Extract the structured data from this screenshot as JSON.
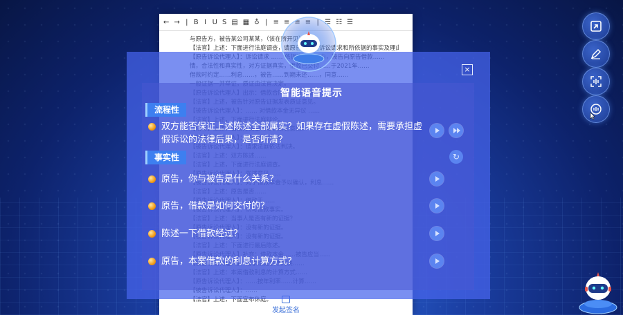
{
  "document": {
    "toolbar_glyphs": [
      "←",
      "→",
      "|",
      "B",
      "I",
      "U",
      "S",
      "▤",
      "▦",
      "♁",
      "|",
      "≡",
      "≡",
      "≡",
      "≡",
      "|",
      "☰",
      "☷",
      "☰"
    ],
    "lines": [
      "与原告方，被告某公司某某，（该在所开见）",
      "【法官】上述：下面进行法庭调查，请原告方陈述诉讼请求和所依据的事实及理由。",
      "【原告诉讼代理人】：诉讼请求 …… 依据事实与理由，被告向原告借款……",
      "情，合法性和真实性，对方证据真实，借款已交付……于2021年……",
      "借款时约定……利息……，被告……到期未还……，同意……",
      "一般证据一并举证，质证由法官决定。",
      "【原告诉讼代理人】出示：借款合同、转账凭证。",
      "【法官】上述，被告针对原告证据发表质证意见。",
      "【被告诉讼代理人】：…… 对借款本金无异议 ……",
      "【法官】上述，下面进行法庭辩论。",
      "【法官】上述：请双方当事人发表辩论意见。",
      "【原告诉讼代理人】：坚持诉讼请求。",
      "【被告诉讼代理人】：请求法庭依法判决。",
      "【法官】上述：双方陈述……",
      "【法官】上述，下面进行法庭调查。",
      "【原告诉讼代理人】：陈述意见……",
      "【被告诉讼代理人】：对于借款本金予以确认，利息……",
      "【法官】上述：原告是否……",
      "【原告诉讼代理人】：借款于……",
      "【被告诉讼代理人】：认可借款事实。",
      "【法官】上述：当事人是否有新的证据？",
      "【原告诉讼代理人】：没有新的证据。",
      "【被告诉讼代理人】：没有新的证据。",
      "【法官】上述：下面进行最后陈述。",
      "【原告诉讼代理人】补充：借款本金……被告应当……",
      "【被告诉讼代理人】：请求法庭依法判决……",
      "【法官】上述：本案借款利息的计算方式……",
      "【原告诉讼代理人】：……按年利率……计算……",
      "【被告诉讼代理人】：……",
      "【法官】上述，下面宣布休庭。"
    ],
    "footer_label": "发起签名"
  },
  "modal": {
    "title": "智能语音提示",
    "close_glyph": "×",
    "sections": [
      {
        "label": "流程性",
        "items": [
          {
            "text": "双方能否保证上述陈述全部属实？如果存在虚假陈述，需要承担虚假诉讼的法律后果，是否听清？"
          }
        ]
      },
      {
        "label": "事实性",
        "items": [
          {
            "text": "原告，你与被告是什么关系？"
          },
          {
            "text": "原告，借款是如何交付的？"
          },
          {
            "text": "陈述一下借款经过？"
          },
          {
            "text": "原告，本案借款的利息计算方式？"
          }
        ]
      }
    ]
  },
  "side_tools": [
    {
      "icon": "screen-capture-icon"
    },
    {
      "icon": "sign-pen-icon"
    },
    {
      "icon": "voice-scan-icon"
    },
    {
      "icon": "voice-prompt-icon"
    }
  ],
  "colors": {
    "accent": "#3d7ff0",
    "bullet": "#f09a18",
    "modal_bg": "#4664eb"
  }
}
